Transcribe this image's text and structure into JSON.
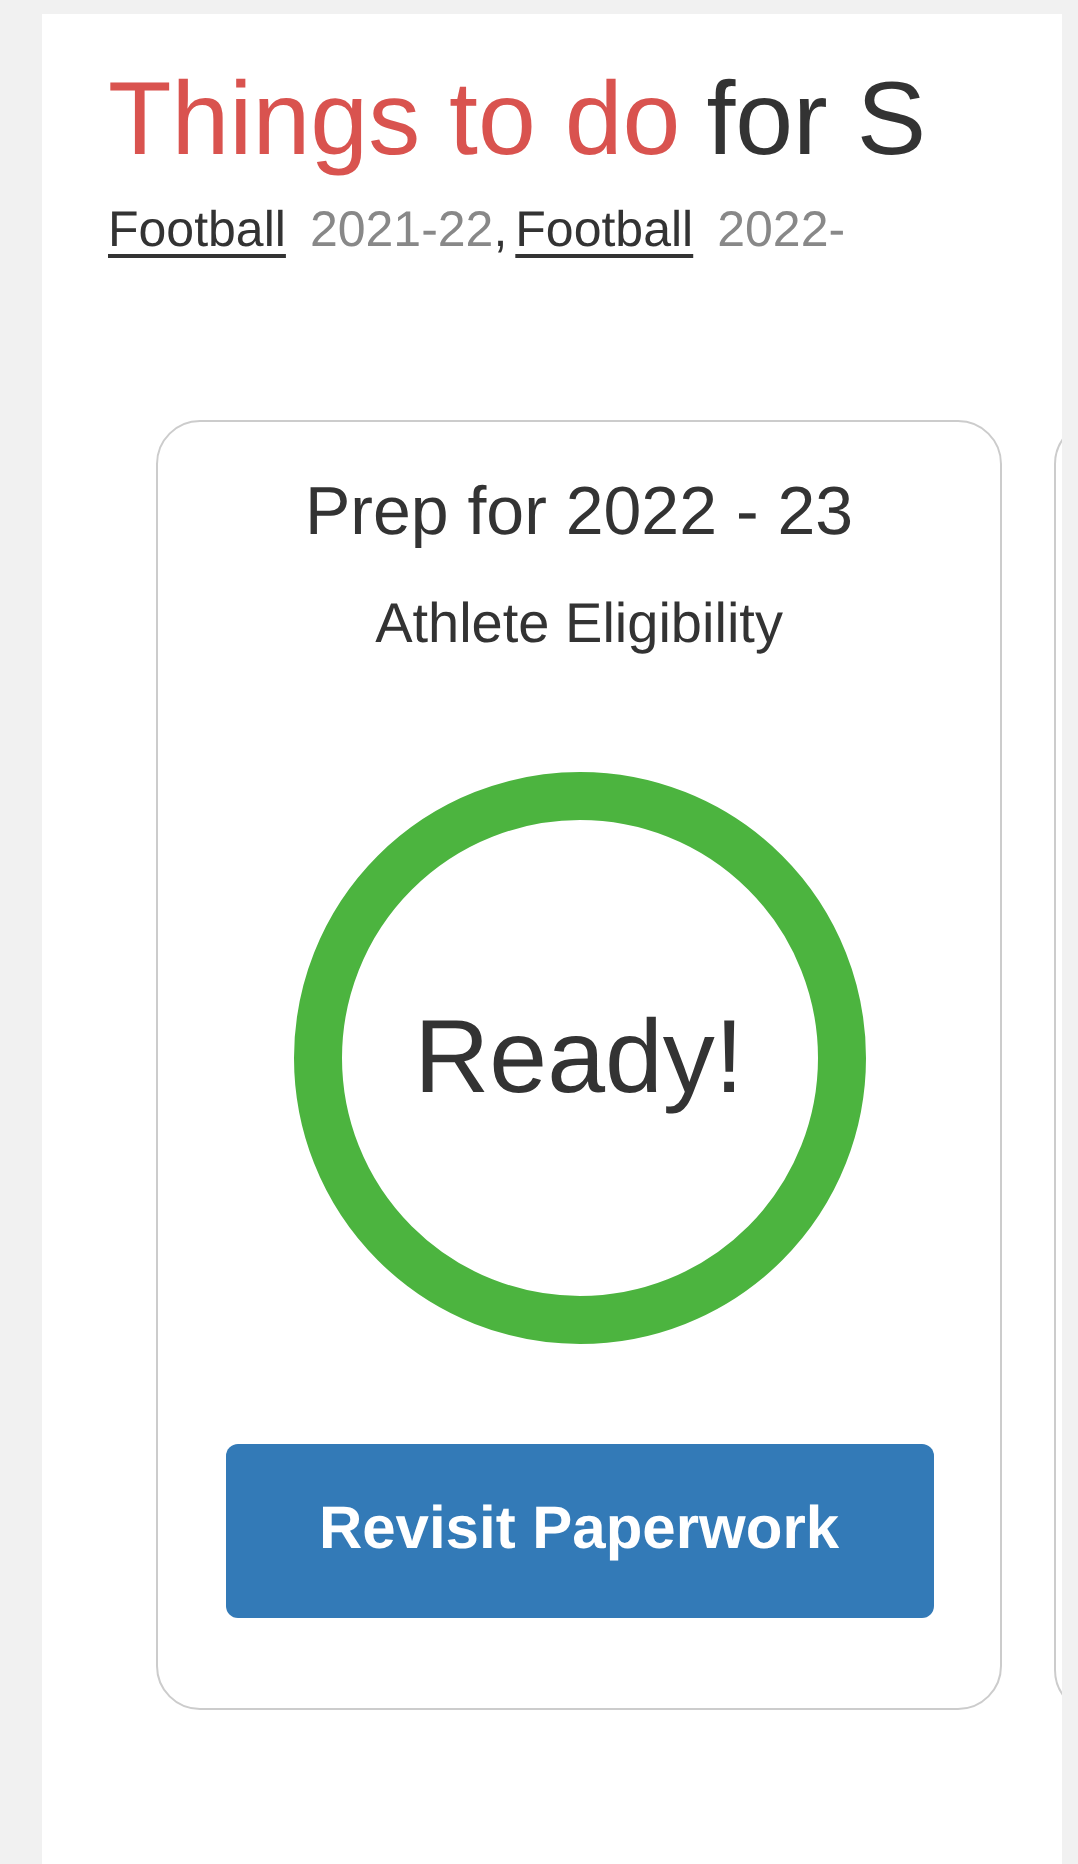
{
  "title": {
    "highlight": "Things to do",
    "rest": "for S"
  },
  "teams": [
    {
      "sport": "Football",
      "season": "2021-22",
      "separator": ","
    },
    {
      "sport": "Football",
      "season": "2022-"
    }
  ],
  "cards": [
    {
      "title": "Prep for 2022 - 23",
      "subtitle": "Athlete Eligibility",
      "status": {
        "label": "Ready!",
        "color": "#4cb43f"
      },
      "button": "Revisit Paperwork"
    }
  ]
}
